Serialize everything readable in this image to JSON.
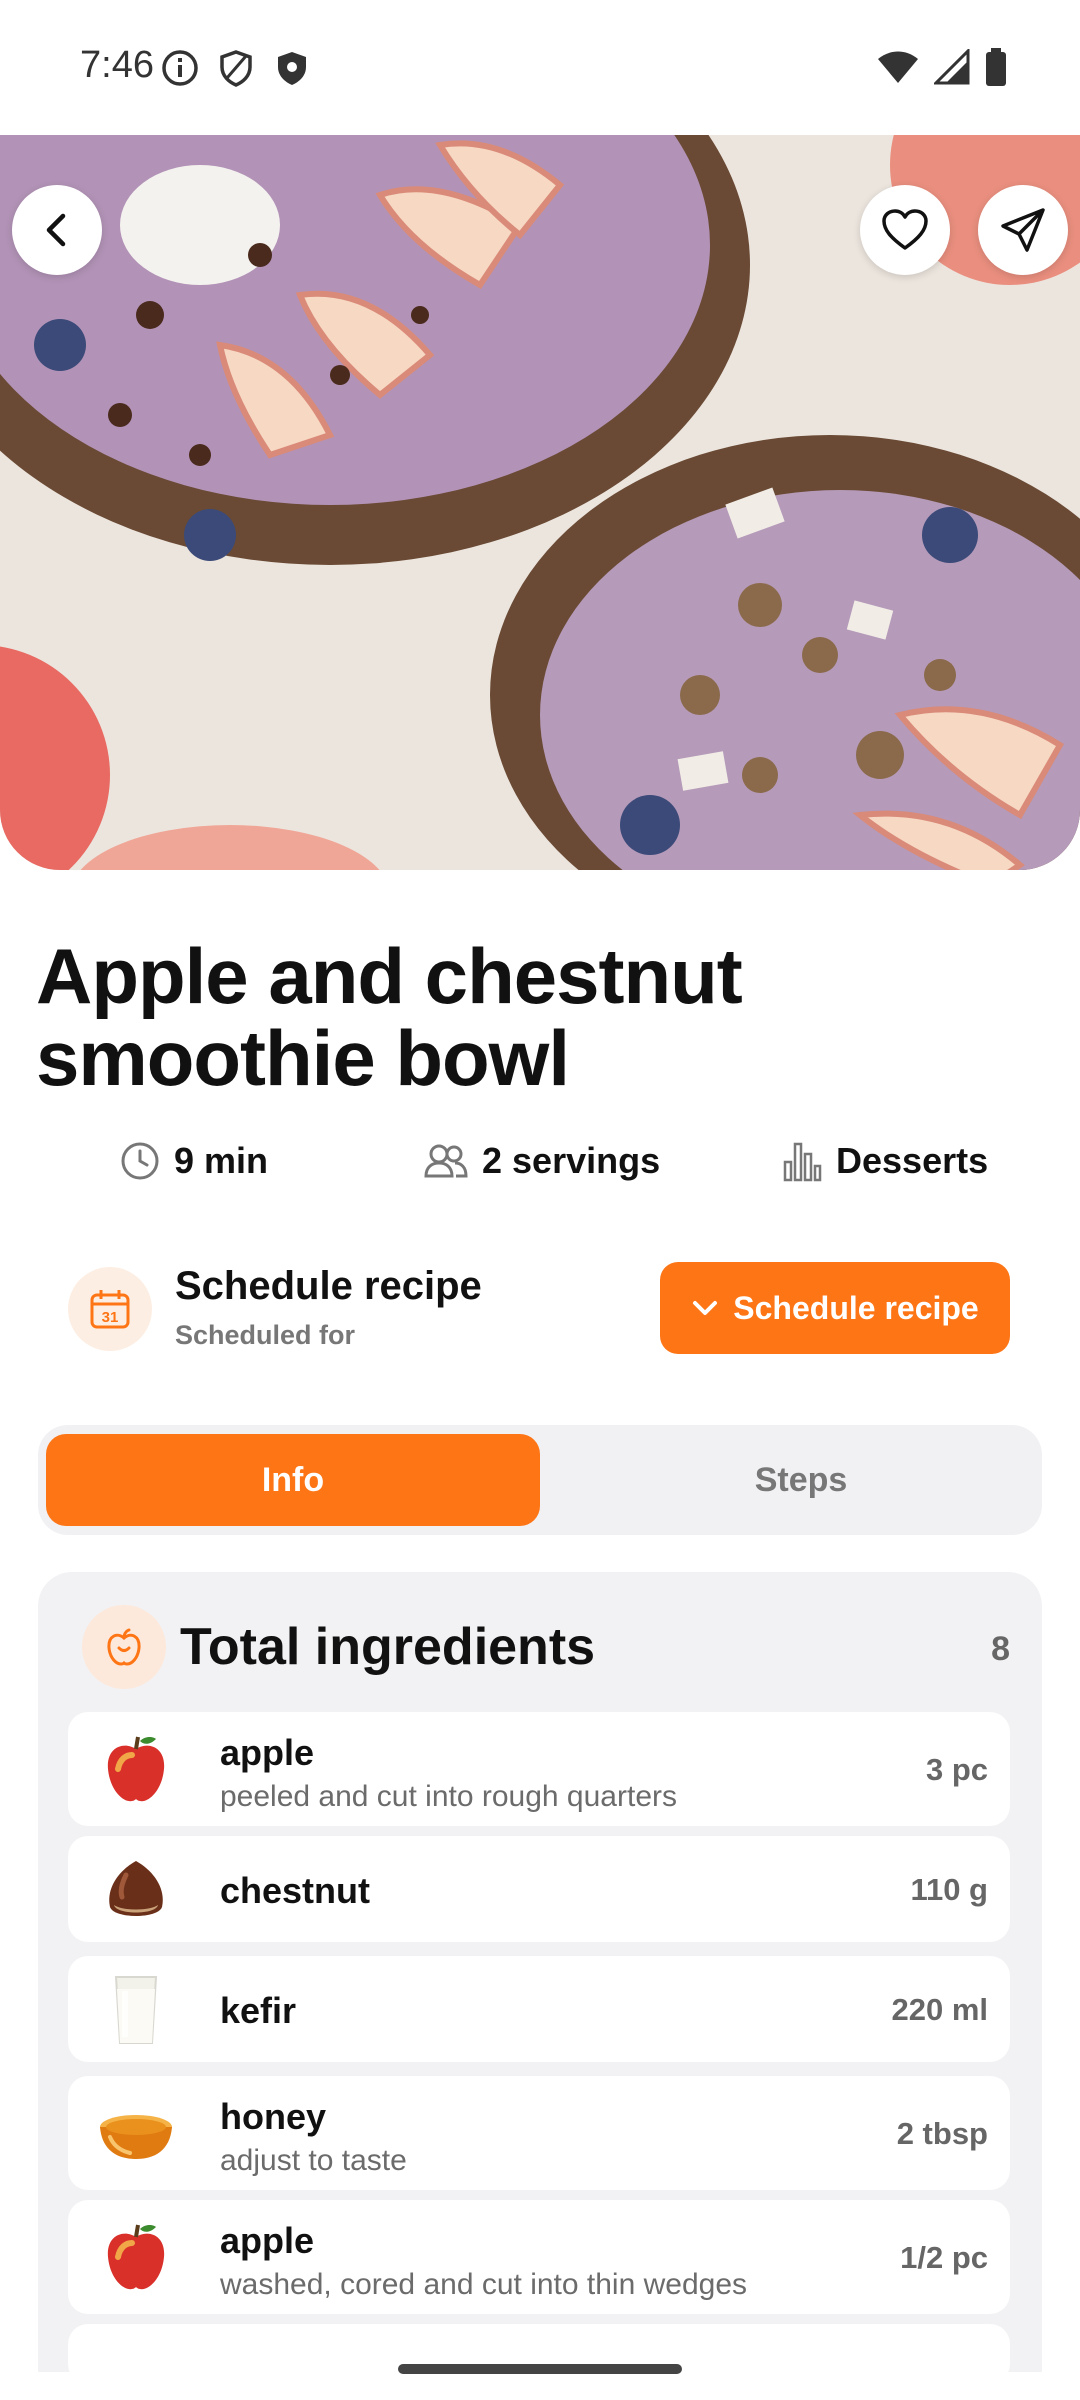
{
  "status_bar": {
    "time": "7:46"
  },
  "hero": {
    "image": "acai-bowls-with-apple-slices-granola-chocolate"
  },
  "actions": {
    "back_icon": "chevron-left-icon",
    "favorite_icon": "heart-icon",
    "share_icon": "send-icon"
  },
  "recipe": {
    "title": "Apple and chestnut smoothie bowl",
    "time": "9 min",
    "servings": "2 servings",
    "category": "Desserts"
  },
  "schedule": {
    "title": "Schedule recipe",
    "subtitle": "Scheduled for",
    "button_label": "Schedule recipe"
  },
  "tabs": [
    {
      "label": "Info",
      "active": true
    },
    {
      "label": "Steps",
      "active": false
    }
  ],
  "ingredients": {
    "title": "Total ingredients",
    "count": "8",
    "items": [
      {
        "name": "apple",
        "note": "peeled and cut into rough quarters",
        "qty": "3 pc",
        "icon": "apple"
      },
      {
        "name": "chestnut",
        "note": "",
        "qty": "110 g",
        "icon": "chestnut"
      },
      {
        "name": "kefir",
        "note": "",
        "qty": "220 ml",
        "icon": "glass-of-kefir"
      },
      {
        "name": "honey",
        "note": "adjust to taste",
        "qty": "2 tbsp",
        "icon": "honey-bowl"
      },
      {
        "name": "apple",
        "note": "washed, cored and cut into thin wedges",
        "qty": "1/2 pc",
        "icon": "apple"
      }
    ]
  },
  "colors": {
    "accent": "#fe7515",
    "card_bg": "#f2f2f4"
  }
}
